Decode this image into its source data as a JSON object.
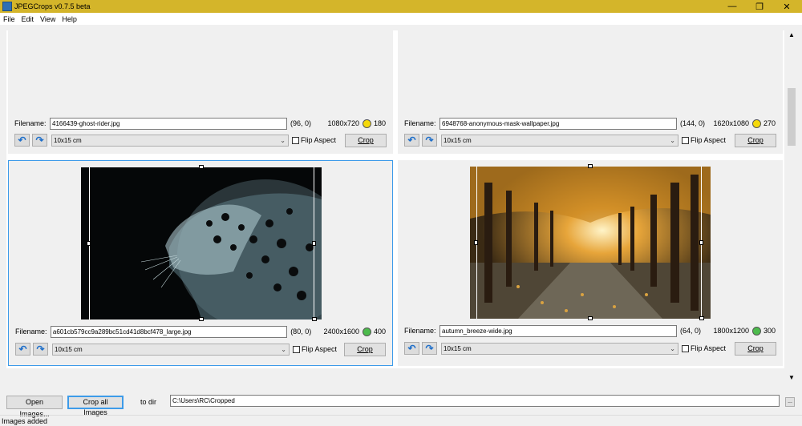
{
  "window": {
    "title": "JPEGCrops v0.7.5 beta",
    "minimize": "—",
    "maximize": "❐",
    "close": "✕"
  },
  "menu": [
    "File",
    "Edit",
    "View",
    "Help"
  ],
  "panels": [
    {
      "filename_label": "Filename:",
      "filename": "4166439-ghost-rider.jpg",
      "offset": "(96, 0)",
      "dims": "1080x720",
      "quality": "180",
      "dot_color": "#f5d90a",
      "size": "10x15 cm",
      "flip_label": "Flip Aspect",
      "crop_label": "Crop",
      "image": "none"
    },
    {
      "filename_label": "Filename:",
      "filename": "6948768-anonymous-mask-wallpaper.jpg",
      "offset": "(144, 0)",
      "dims": "1620x1080",
      "quality": "270",
      "dot_color": "#f5d90a",
      "size": "10x15 cm",
      "flip_label": "Flip Aspect",
      "crop_label": "Crop",
      "image": "none"
    },
    {
      "filename_label": "Filename:",
      "filename": "a601cb579cc9a289bc51cd41d8bcf478_large.jpg",
      "offset": "(80, 0)",
      "dims": "2400x1600",
      "quality": "400",
      "dot_color": "#4cbb4c",
      "size": "10x15 cm",
      "flip_label": "Flip Aspect",
      "crop_label": "Crop",
      "image": "leopard"
    },
    {
      "filename_label": "Filename:",
      "filename": "autumn_breeze-wide.jpg",
      "offset": "(64, 0)",
      "dims": "1800x1200",
      "quality": "300",
      "dot_color": "#4cbb4c",
      "size": "10x15 cm",
      "flip_label": "Flip Aspect",
      "crop_label": "Crop",
      "image": "autumn"
    }
  ],
  "bottom": {
    "open_label": "Open Images...",
    "crop_all_label": "Crop all Images",
    "to_dir_label": "to dir",
    "dir_value": "C:\\Users\\RC\\Cropped",
    "browse_label": "..."
  },
  "status": "Images added"
}
